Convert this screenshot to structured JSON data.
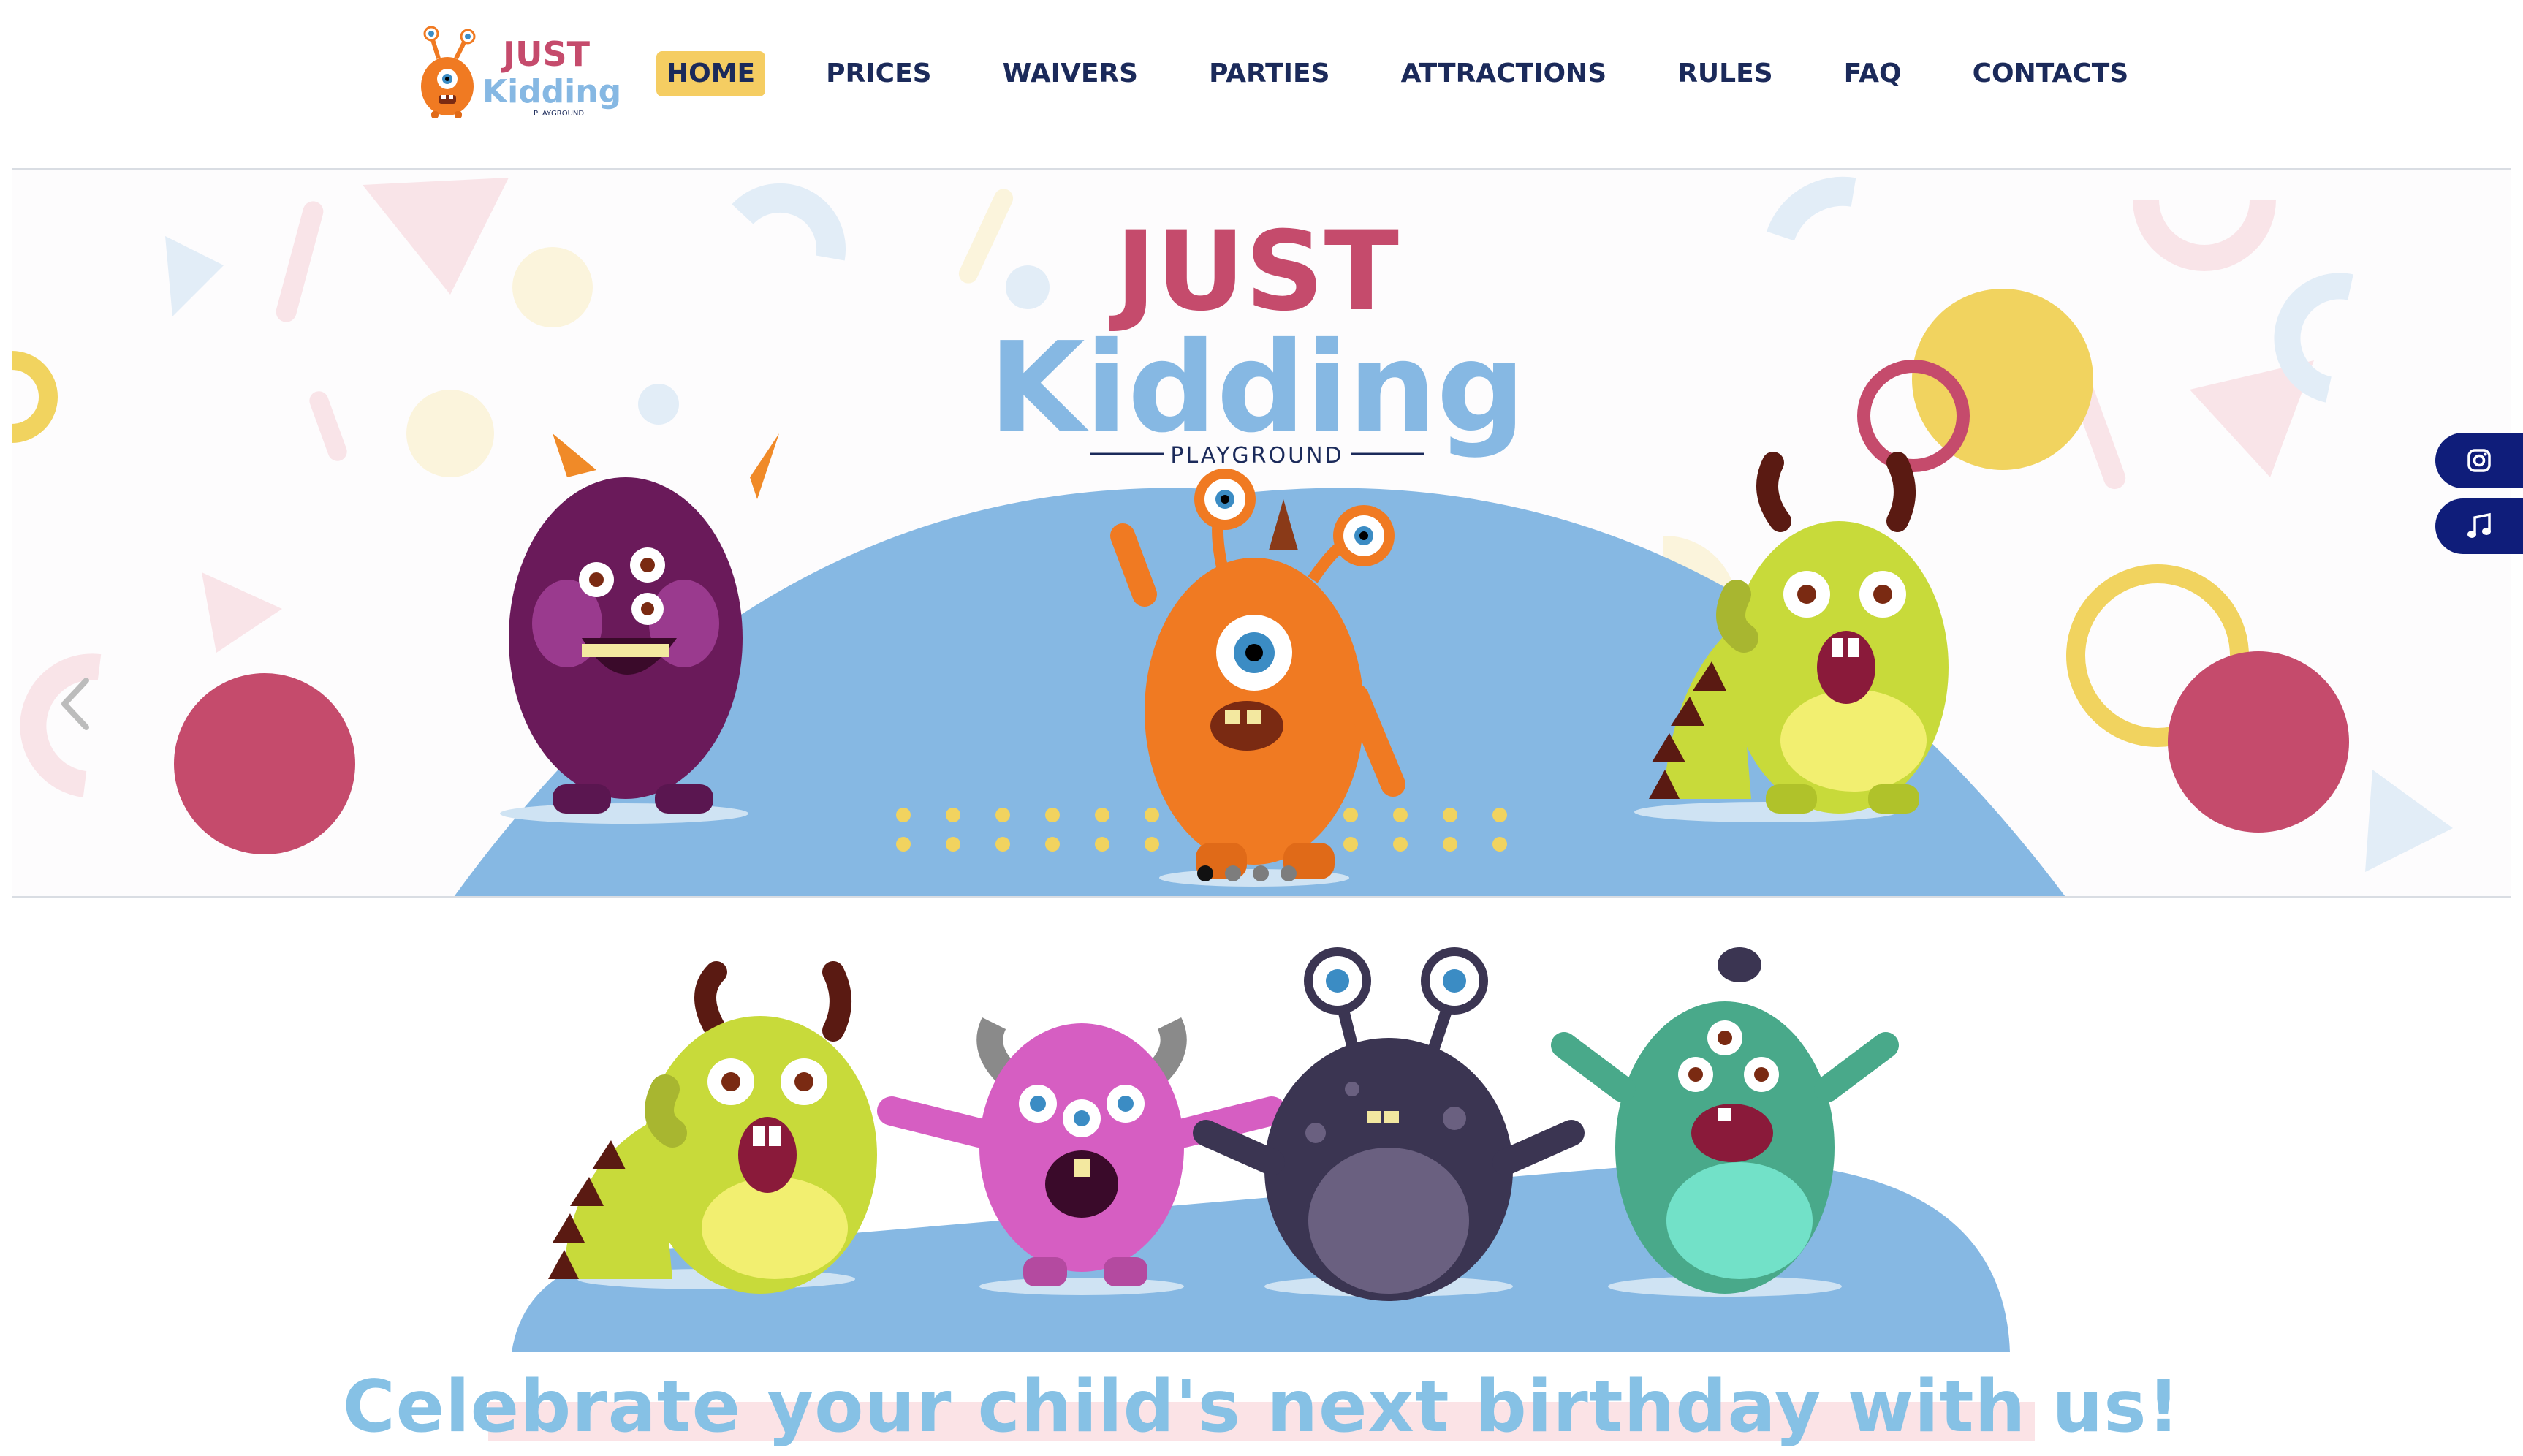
{
  "header": {
    "logo": {
      "line1": "JUST",
      "line2": "Kidding",
      "line3": "PLAYGROUND"
    },
    "nav": [
      {
        "label": "HOME",
        "active": true
      },
      {
        "label": "PRICES",
        "active": false
      },
      {
        "label": "WAIVERS",
        "active": false
      },
      {
        "label": "PARTIES",
        "active": false
      },
      {
        "label": "ATTRACTIONS",
        "active": false
      },
      {
        "label": "RULES",
        "active": false
      },
      {
        "label": "FAQ",
        "active": false
      },
      {
        "label": "CONTACTS",
        "active": false
      }
    ]
  },
  "hero": {
    "logo": {
      "line1": "JUST",
      "line2": "Kidding",
      "line3": "PLAYGROUND"
    },
    "slides": 4,
    "active_slide": 1,
    "prev_icon": "chevron-left-icon"
  },
  "social": [
    {
      "name": "instagram",
      "icon": "instagram-icon"
    },
    {
      "name": "tiktok",
      "icon": "music-note-icon"
    }
  ],
  "party": {
    "headline": "Celebrate your child's next birthday with us!"
  },
  "colors": {
    "navy": "#1b2a5a",
    "nav_active": "#f5cd62",
    "sky": "#86b8e3",
    "magenta": "#c54b6c",
    "yellow": "#f1d35f",
    "social_bg": "#0f1d7a",
    "headline": "#86c1e5"
  }
}
